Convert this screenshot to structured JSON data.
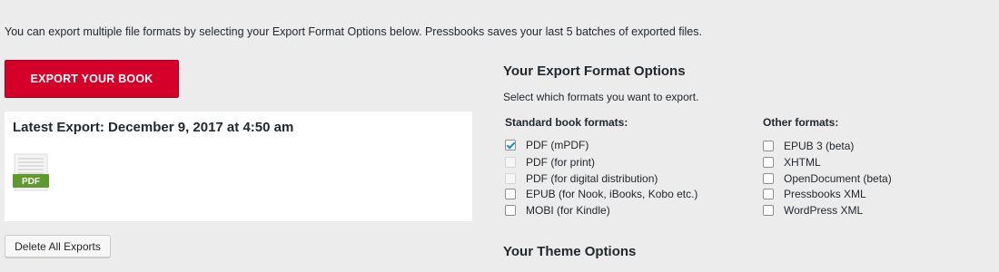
{
  "intro_text": "You can export multiple file formats by selecting your Export Format Options below. Pressbooks saves your last 5 batches of exported files.",
  "export_button_label": "EXPORT YOUR BOOK",
  "latest_export": {
    "title": "Latest Export: December 9, 2017 at 4:50 am",
    "file_badge": "PDF"
  },
  "delete_button_label": "Delete All Exports",
  "export_options": {
    "heading": "Your Export Format Options",
    "subheading": "Select which formats you want to export.",
    "standard": {
      "heading": "Standard book formats:",
      "items": [
        {
          "label": "PDF (mPDF)",
          "checked": true,
          "disabled": false
        },
        {
          "label": "PDF (for print)",
          "checked": false,
          "disabled": true
        },
        {
          "label": "PDF (for digital distribution)",
          "checked": false,
          "disabled": true
        },
        {
          "label": "EPUB (for Nook, iBooks, Kobo etc.)",
          "checked": false,
          "disabled": false
        },
        {
          "label": "MOBI (for Kindle)",
          "checked": false,
          "disabled": false
        }
      ]
    },
    "other": {
      "heading": "Other formats:",
      "items": [
        {
          "label": "EPUB 3 (beta)",
          "checked": false,
          "disabled": false
        },
        {
          "label": "XHTML",
          "checked": false,
          "disabled": false
        },
        {
          "label": "OpenDocument (beta)",
          "checked": false,
          "disabled": false
        },
        {
          "label": "Pressbooks XML",
          "checked": false,
          "disabled": false
        },
        {
          "label": "WordPress XML",
          "checked": false,
          "disabled": false
        }
      ]
    }
  },
  "theme_heading": "Your Theme Options",
  "colors": {
    "accent_red": "#d4002a",
    "pdf_badge_green": "#5f9a2f",
    "checkmark_blue": "#1e8cbe"
  }
}
